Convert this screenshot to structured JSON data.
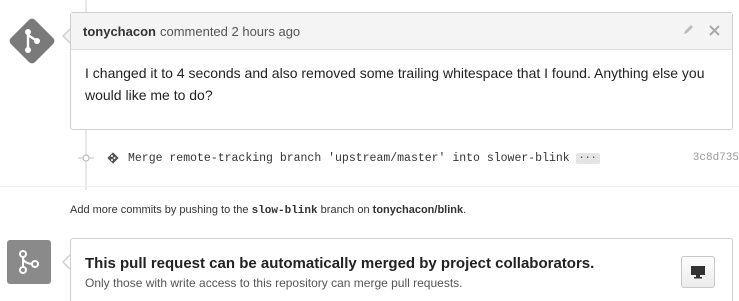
{
  "comment": {
    "author": "tonychacon",
    "meta": "commented 2 hours ago",
    "body": "I changed it to 4 seconds and also removed some trailing whitespace that I found. Anything else you would like me to do?",
    "edit_icon": "pencil-icon",
    "delete_icon": "close-icon"
  },
  "commit": {
    "message": "Merge remote-tracking branch 'upstream/master' into slower-blink",
    "ellipsis": "···",
    "sha": "3c8d735"
  },
  "hint": {
    "prefix": "Add more commits by pushing to the ",
    "branch": "slow-blink",
    "middle": " branch on ",
    "repo": "tonychacon/blink",
    "suffix": "."
  },
  "merge": {
    "title": "This pull request can be automatically merged by project collaborators.",
    "subtitle": "Only those with write access to this repository can merge pull requests.",
    "button_icon": "desktop-icon"
  },
  "colors": {
    "avatar_gray": "#8a8a8a",
    "header_bg": "#f4f4f4"
  }
}
